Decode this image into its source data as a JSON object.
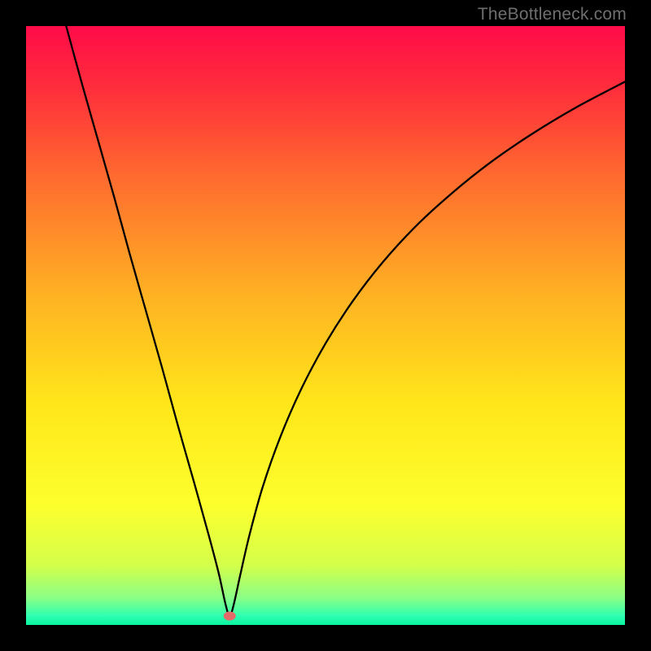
{
  "watermark": "TheBottleneck.com",
  "chart_data": {
    "type": "line",
    "title": "",
    "xlabel": "",
    "ylabel": "",
    "xlim": [
      0,
      100
    ],
    "ylim": [
      0,
      100
    ],
    "grid": false,
    "legend": false,
    "background_gradient": {
      "stops": [
        {
          "pos": 0.0,
          "color": "#ff0b48"
        },
        {
          "pos": 0.1,
          "color": "#ff2c3c"
        },
        {
          "pos": 0.25,
          "color": "#ff6a2f"
        },
        {
          "pos": 0.45,
          "color": "#ffb223"
        },
        {
          "pos": 0.63,
          "color": "#ffe61a"
        },
        {
          "pos": 0.8,
          "color": "#fdff2d"
        },
        {
          "pos": 0.9,
          "color": "#d4ff4a"
        },
        {
          "pos": 0.955,
          "color": "#8aff86"
        },
        {
          "pos": 0.985,
          "color": "#2dffb0"
        },
        {
          "pos": 1.0,
          "color": "#08f3a0"
        }
      ]
    },
    "marker": {
      "x_pct": 34.0,
      "y_pct": 98.5,
      "color": "#e46a6a"
    },
    "series": [
      {
        "name": "curve",
        "color": "#000000",
        "points": [
          {
            "x_pct": 6.7,
            "y_pct": 0.0
          },
          {
            "x_pct": 9.3,
            "y_pct": 9.5
          },
          {
            "x_pct": 12.0,
            "y_pct": 19.0
          },
          {
            "x_pct": 14.7,
            "y_pct": 28.5
          },
          {
            "x_pct": 17.3,
            "y_pct": 38.0
          },
          {
            "x_pct": 20.0,
            "y_pct": 47.5
          },
          {
            "x_pct": 22.7,
            "y_pct": 57.0
          },
          {
            "x_pct": 25.3,
            "y_pct": 66.5
          },
          {
            "x_pct": 28.0,
            "y_pct": 76.0
          },
          {
            "x_pct": 30.5,
            "y_pct": 85.0
          },
          {
            "x_pct": 32.2,
            "y_pct": 91.5
          },
          {
            "x_pct": 33.3,
            "y_pct": 96.5
          },
          {
            "x_pct": 34.0,
            "y_pct": 98.5
          },
          {
            "x_pct": 34.7,
            "y_pct": 96.5
          },
          {
            "x_pct": 35.8,
            "y_pct": 91.5
          },
          {
            "x_pct": 37.3,
            "y_pct": 85.0
          },
          {
            "x_pct": 39.5,
            "y_pct": 77.0
          },
          {
            "x_pct": 42.5,
            "y_pct": 68.5
          },
          {
            "x_pct": 46.0,
            "y_pct": 60.5
          },
          {
            "x_pct": 50.0,
            "y_pct": 53.0
          },
          {
            "x_pct": 54.5,
            "y_pct": 46.0
          },
          {
            "x_pct": 59.5,
            "y_pct": 39.5
          },
          {
            "x_pct": 65.0,
            "y_pct": 33.5
          },
          {
            "x_pct": 71.0,
            "y_pct": 28.0
          },
          {
            "x_pct": 77.5,
            "y_pct": 22.8
          },
          {
            "x_pct": 84.5,
            "y_pct": 18.0
          },
          {
            "x_pct": 92.0,
            "y_pct": 13.5
          },
          {
            "x_pct": 100.0,
            "y_pct": 9.3
          }
        ]
      }
    ]
  }
}
